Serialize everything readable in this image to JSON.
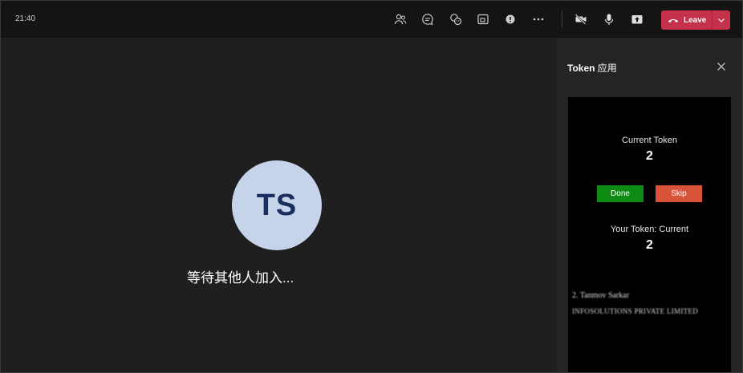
{
  "topbar": {
    "time": "21:40",
    "tools": [
      {
        "icon": "people-icon",
        "name": "participants-button"
      },
      {
        "icon": "chat-icon",
        "name": "chat-button"
      },
      {
        "icon": "reactions-icon",
        "name": "reactions-button"
      },
      {
        "icon": "share-screen-icon",
        "name": "rooms-button"
      },
      {
        "icon": "apps-icon",
        "name": "apps-button"
      },
      {
        "icon": "more-icon",
        "name": "more-button"
      }
    ],
    "leave_label": "Leave",
    "leave_color": "#c4314b"
  },
  "stage": {
    "avatar_initials": "TS",
    "waiting_text": "等待其他人加入..."
  },
  "panel": {
    "title_bold": "Token",
    "title_rest": " 应用",
    "app": {
      "current_token_label": "Current Token",
      "current_token_value": "2",
      "done_label": "Done",
      "skip_label": "Skip",
      "your_token_label": "Your Token: Current",
      "your_token_value": "2",
      "list_line1": "2. Tanmoy Sarkar",
      "list_line2": "INFOSOLUTIONS PRIVATE LIMITED"
    }
  }
}
